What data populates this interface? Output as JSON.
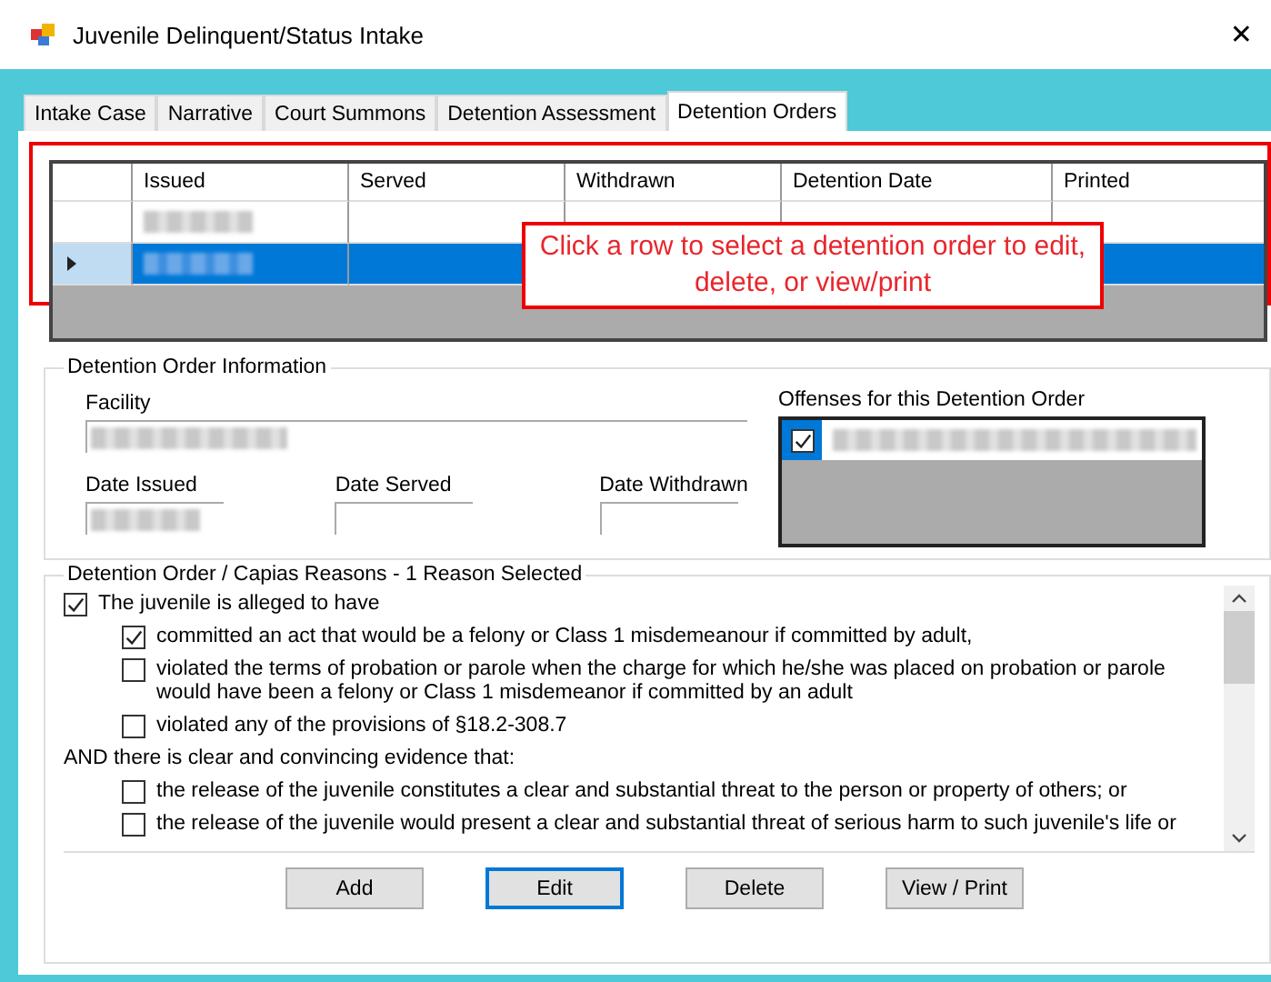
{
  "window": {
    "title": "Juvenile Delinquent/Status Intake",
    "close": "✕"
  },
  "tabs": [
    {
      "label": "Intake Case",
      "selected": false
    },
    {
      "label": "Narrative",
      "selected": false
    },
    {
      "label": "Court Summons",
      "selected": false
    },
    {
      "label": "Detention Assessment",
      "selected": false
    },
    {
      "label": "Detention Orders",
      "selected": true
    }
  ],
  "orders_table": {
    "columns": [
      "Issued",
      "Served",
      "Withdrawn",
      "Detention Date",
      "Printed"
    ],
    "rows": [
      {
        "selected": false
      },
      {
        "selected": true
      }
    ]
  },
  "callout": {
    "text": "Click a row to select a detention order to edit, delete, or view/print"
  },
  "info": {
    "title": "Detention Order Information",
    "facility_label": "Facility",
    "date_issued_label": "Date Issued",
    "date_served_label": "Date Served",
    "date_withdrawn_label": "Date Withdrawn",
    "offenses_label": "Offenses for this Detention Order",
    "offenses": [
      {
        "checked": true
      }
    ]
  },
  "reasons": {
    "title": "Detention Order / Capias Reasons - 1 Reason Selected",
    "items": [
      {
        "kind": "checkbox",
        "label": "The juvenile is alleged to have",
        "checked": true,
        "children": [
          {
            "kind": "checkbox",
            "label": "committed an act that would be a felony or Class 1 misdemeanour if committed by adult,",
            "checked": true
          },
          {
            "kind": "checkbox",
            "label": "violated the terms of probation or parole when the charge for which he/she was placed on probation or parole would have been a felony or Class 1 misdemeanor if committed by an adult",
            "checked": false
          },
          {
            "kind": "checkbox",
            "label": "violated any of the provisions of §18.2-308.7",
            "checked": false
          }
        ]
      },
      {
        "kind": "heading",
        "label": "AND there is clear and convincing evidence that:",
        "children": [
          {
            "kind": "checkbox",
            "label": "the release of the juvenile constitutes a clear and substantial threat to the person or property of others; or",
            "checked": false
          },
          {
            "kind": "checkbox",
            "label": "the release of the juvenile would present a clear and substantial threat of serious harm to such juvenile's life or",
            "checked": false
          }
        ]
      }
    ]
  },
  "buttons": [
    {
      "label": "Add",
      "selected": false
    },
    {
      "label": "Edit",
      "selected": true
    },
    {
      "label": "Delete",
      "selected": false
    },
    {
      "label": "View / Print",
      "selected": false
    }
  ]
}
